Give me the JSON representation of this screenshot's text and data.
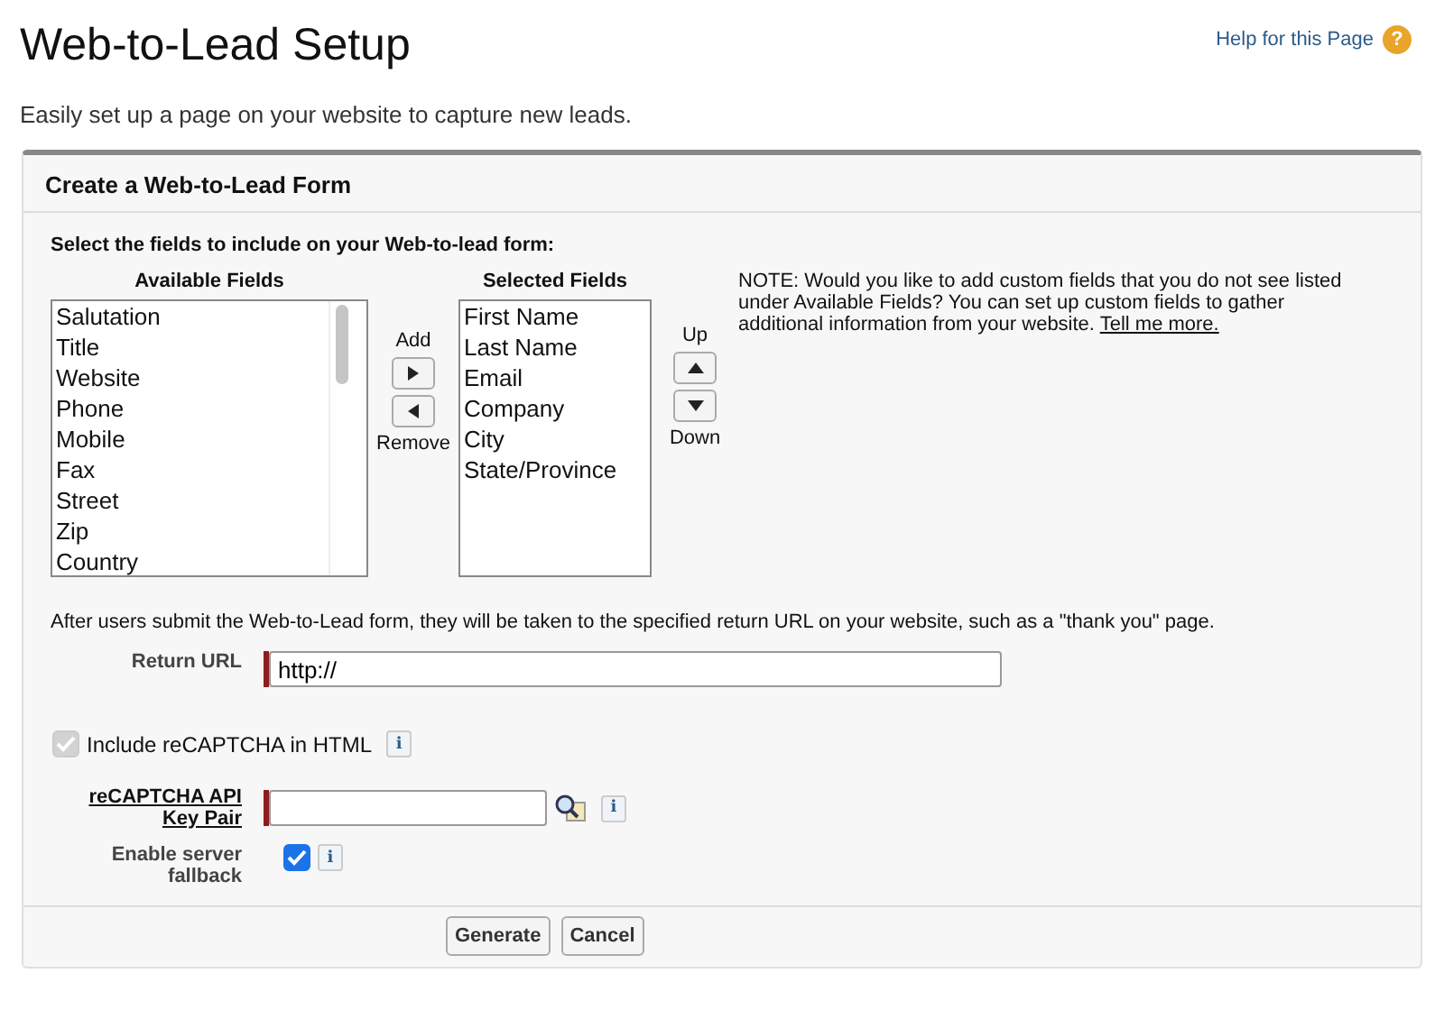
{
  "page": {
    "title": "Web-to-Lead Setup",
    "help_link": "Help for this Page",
    "help_icon": "?",
    "subtitle": "Easily set up a page on your website to capture new leads."
  },
  "panel": {
    "title": "Create a Web-to-Lead Form",
    "instruction": "Select the fields to include on your Web-to-lead form:",
    "available": {
      "heading": "Available Fields",
      "items": [
        "Salutation",
        "Title",
        "Website",
        "Phone",
        "Mobile",
        "Fax",
        "Street",
        "Zip",
        "Country"
      ]
    },
    "add_label": "Add",
    "remove_label": "Remove",
    "selected": {
      "heading": "Selected Fields",
      "items": [
        "First Name",
        "Last Name",
        "Email",
        "Company",
        "City",
        "State/Province"
      ]
    },
    "up_label": "Up",
    "down_label": "Down",
    "note": "NOTE: Would you like to add custom fields that you do not see listed under Available Fields? You can set up custom fields to gather additional information from your website.",
    "note_link": "Tell me more.",
    "return_info": "After users submit the Web-to-Lead form, they will be taken to the specified return URL on your website, such as a \"thank you\" page.",
    "return_url": {
      "label": "Return URL",
      "value": "http://",
      "required": true
    },
    "recaptcha": {
      "label": "Include reCAPTCHA in HTML",
      "checked": true,
      "disabled": true,
      "info": "i"
    },
    "key_pair": {
      "label": "reCAPTCHA API Key Pair",
      "required": true,
      "info": "i"
    },
    "fallback": {
      "label": "Enable server fallback",
      "checked": true,
      "info": "i"
    },
    "buttons": [
      "Generate",
      "Cancel"
    ]
  }
}
